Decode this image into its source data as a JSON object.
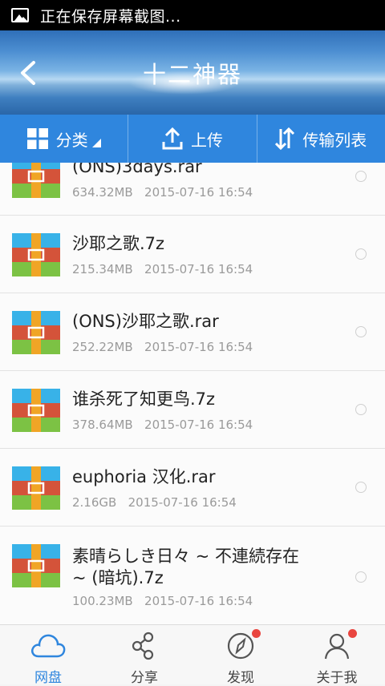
{
  "status_bar": {
    "text": "正在保存屏幕截图..."
  },
  "header": {
    "title": "十二神器"
  },
  "toolbar": {
    "category_label": "分类",
    "upload_label": "上传",
    "transfer_label": "传输列表"
  },
  "files": [
    {
      "name": "(ONS)3days.rar",
      "size": "634.32MB",
      "date": "2015-07-16  16:54"
    },
    {
      "name": "沙耶之歌.7z",
      "size": "215.34MB",
      "date": "2015-07-16  16:54"
    },
    {
      "name": "(ONS)沙耶之歌.rar",
      "size": "252.22MB",
      "date": "2015-07-16  16:54"
    },
    {
      "name": "谁杀死了知更鸟.7z",
      "size": "378.64MB",
      "date": "2015-07-16  16:54"
    },
    {
      "name": "euphoria 汉化.rar",
      "size": "2.16GB",
      "date": "2015-07-16  16:54"
    },
    {
      "name": "素晴らしき日々 ~ 不連続存在 ~ (暗坑).7z",
      "size": "100.23MB",
      "date": "2015-07-16  16:54"
    }
  ],
  "nav": {
    "disk_label": "网盘",
    "share_label": "分享",
    "discover_label": "发现",
    "about_label": "关于我"
  },
  "colors": {
    "accent": "#2f86de",
    "badge": "#e9453f"
  }
}
